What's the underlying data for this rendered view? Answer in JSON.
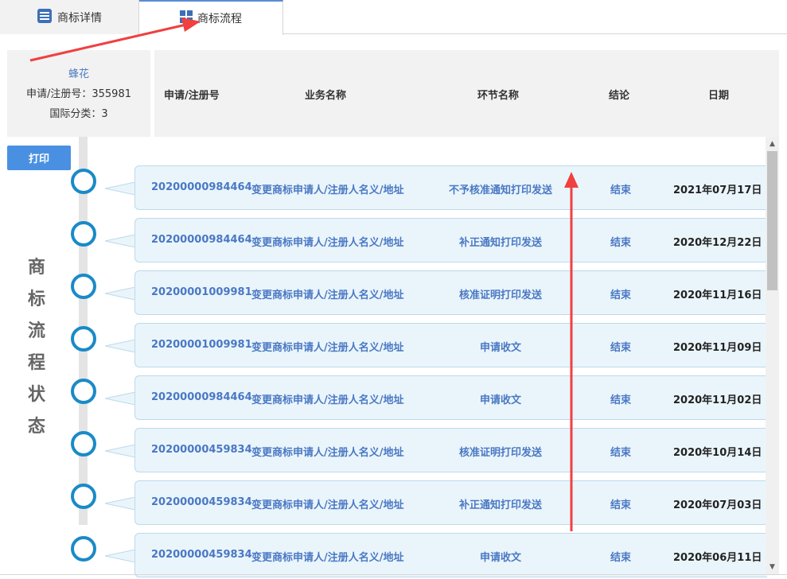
{
  "tabs": [
    {
      "label": "商标详情",
      "icon": "document-list-icon"
    },
    {
      "label": "商标流程",
      "icon": "grid-icon"
    }
  ],
  "trademark": {
    "name": "蜂花",
    "reg_label": "申请/注册号：355981",
    "class_label": "国际分类：3"
  },
  "table_header": {
    "app_no": "申请/注册号",
    "business": "业务名称",
    "step": "环节名称",
    "result": "结论",
    "date": "日期"
  },
  "print_label": "打印",
  "status_title": [
    "商",
    "标",
    "流",
    "程",
    "状",
    "态"
  ],
  "rows": [
    {
      "no": "20200000984464",
      "business": "变更商标申请人/注册人名义/地址",
      "step": "不予核准通知打印发送",
      "result": "结束",
      "date": "2021年07月17日"
    },
    {
      "no": "20200000984464",
      "business": "变更商标申请人/注册人名义/地址",
      "step": "补正通知打印发送",
      "result": "结束",
      "date": "2020年12月22日"
    },
    {
      "no": "20200001009981",
      "business": "变更商标申请人/注册人名义/地址",
      "step": "核准证明打印发送",
      "result": "结束",
      "date": "2020年11月16日"
    },
    {
      "no": "20200001009981",
      "business": "变更商标申请人/注册人名义/地址",
      "step": "申请收文",
      "result": "结束",
      "date": "2020年11月09日"
    },
    {
      "no": "20200000984464",
      "business": "变更商标申请人/注册人名义/地址",
      "step": "申请收文",
      "result": "结束",
      "date": "2020年11月02日"
    },
    {
      "no": "20200000459834",
      "business": "变更商标申请人/注册人名义/地址",
      "step": "核准证明打印发送",
      "result": "结束",
      "date": "2020年10月14日"
    },
    {
      "no": "20200000459834",
      "business": "变更商标申请人/注册人名义/地址",
      "step": "补正通知打印发送",
      "result": "结束",
      "date": "2020年07月03日"
    },
    {
      "no": "20200000459834",
      "business": "变更商标申请人/注册人名义/地址",
      "step": "申请收文",
      "result": "结束",
      "date": "2020年06月11日"
    }
  ],
  "colors": {
    "accent": "#4a78c4",
    "circle": "#1a8ac8",
    "bubble": "#eaf5fb",
    "button": "#4a90e2",
    "annotation_arrow": "#f04040"
  }
}
